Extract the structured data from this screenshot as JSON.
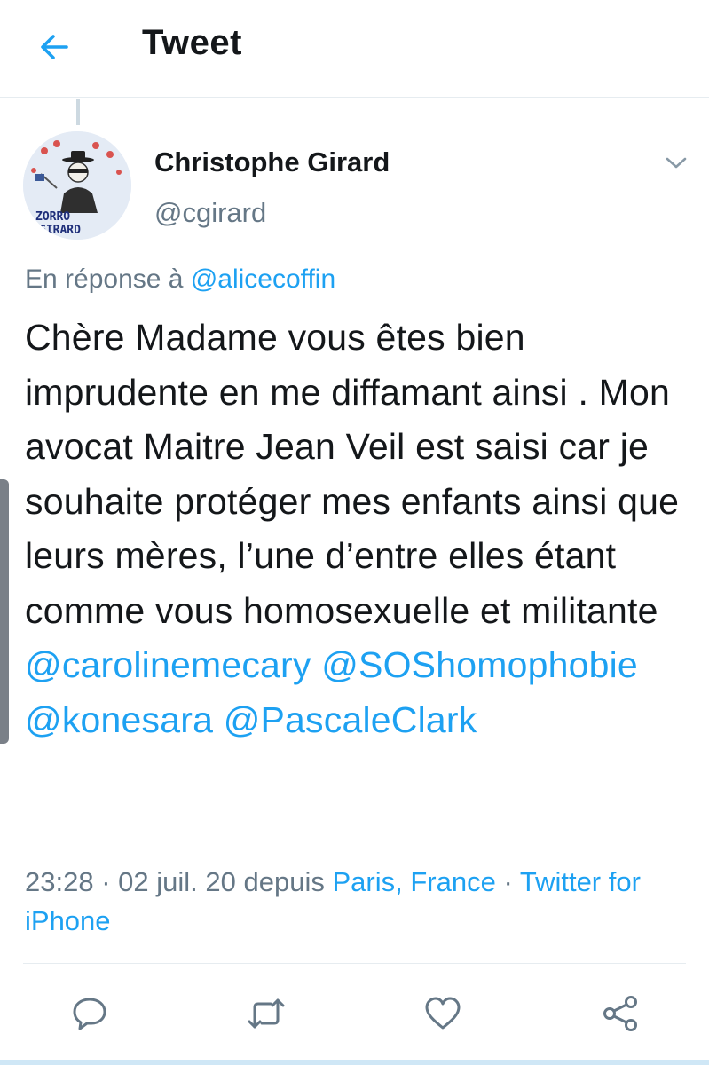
{
  "header": {
    "title": "Tweet",
    "back_icon": "arrow-left-icon"
  },
  "tweet": {
    "author": {
      "name": "Christophe Girard",
      "handle": "@cgirard",
      "avatar_caption_line1": "ZORRO",
      "avatar_caption_line2": "GIRARD"
    },
    "reply_to": {
      "prefix": "En réponse à",
      "handle": "@alicecoffin"
    },
    "text": {
      "body": "Chère Madame vous êtes bien imprudente en me diffamant ainsi . Mon avocat Maitre Jean Veil est saisi car je souhaite protéger mes enfants ainsi que leurs mères, l’une d’entre elles étant comme vous homosexuelle et militante",
      "mentions": [
        "@carolinemecary",
        "@SOShomophobie",
        "@konesara",
        "@PascaleClark"
      ]
    },
    "meta": {
      "time": "23:28",
      "separator": "·",
      "date": "02 juil. 20",
      "via": "depuis",
      "location": "Paris, France",
      "client": "Twitter for iPhone"
    }
  },
  "actions": [
    {
      "name": "reply",
      "icon": "comment-icon"
    },
    {
      "name": "retweet",
      "icon": "retweet-icon"
    },
    {
      "name": "like",
      "icon": "heart-icon"
    },
    {
      "name": "share",
      "icon": "share-icon"
    }
  ],
  "colors": {
    "accent": "#1da1f2",
    "text": "#14171a",
    "secondary": "#657786"
  }
}
